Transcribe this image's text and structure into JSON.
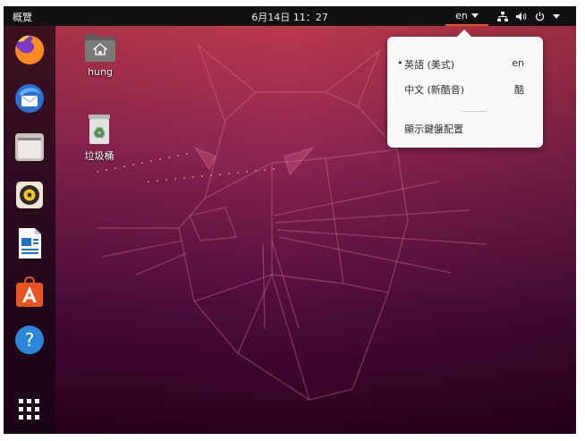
{
  "topbar": {
    "activities_label": "概覽",
    "clock": "6月14日  11：27",
    "language_indicator": "en"
  },
  "systray": {
    "network_icon": "network-wired-icon",
    "volume_icon": "volume-icon",
    "power_icon": "power-icon"
  },
  "dock": {
    "items": [
      {
        "name": "firefox",
        "icon": "firefox-icon"
      },
      {
        "name": "thunderbird",
        "icon": "thunderbird-mail-icon"
      },
      {
        "name": "files",
        "icon": "files-folder-icon"
      },
      {
        "name": "rhythmbox",
        "icon": "rhythmbox-speaker-icon"
      },
      {
        "name": "libreoffice-writer",
        "icon": "writer-document-icon"
      },
      {
        "name": "ubuntu-software",
        "icon": "software-center-bag-icon"
      },
      {
        "name": "help",
        "icon": "help-question-icon"
      },
      {
        "name": "show-applications",
        "icon": "app-grid-icon"
      }
    ]
  },
  "desktop": {
    "home_label": "hung",
    "trash_label": "垃圾桶"
  },
  "language_menu": {
    "items": [
      {
        "label": "英語 (美式)",
        "code": "en",
        "selected_marker": "•"
      },
      {
        "label": "中文 (新酷音)",
        "code": "酷"
      }
    ],
    "show_layout": "顯示鍵盤配置"
  },
  "colors": {
    "topbar": "#111111",
    "accent": "#e95420",
    "wallpaper_top": "#bf3a4a",
    "wallpaper_bottom": "#2c001e"
  }
}
